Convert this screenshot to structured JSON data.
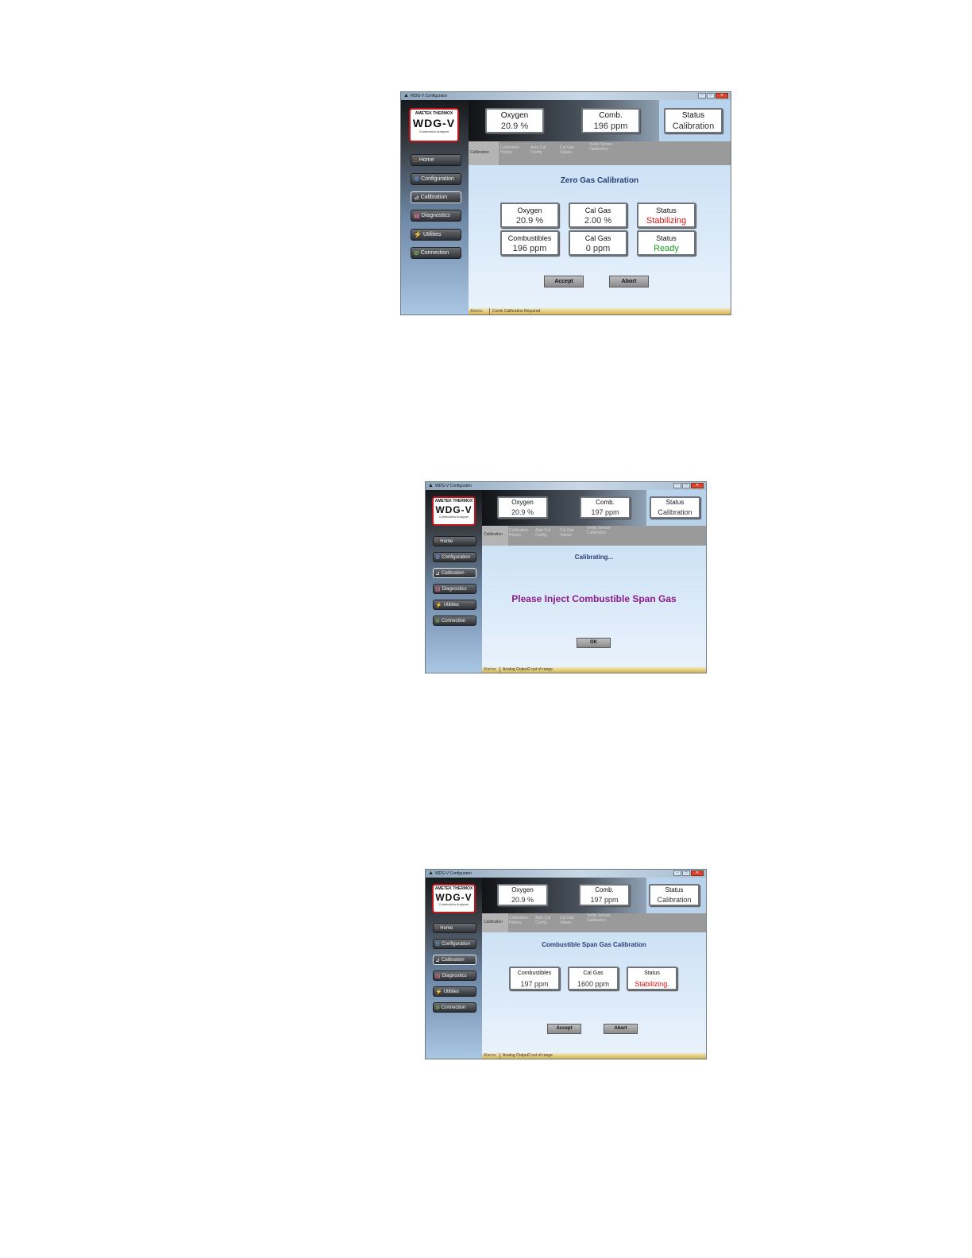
{
  "window_title": "WDG-V Configurator",
  "logo": {
    "brand": "AMETEK THERMOX",
    "product": "WDG-V",
    "subtitle": "Combustion Analyzer"
  },
  "nav": [
    {
      "label": "Home",
      "icon": "home-icon"
    },
    {
      "label": "Configuration",
      "icon": "gear-icon"
    },
    {
      "label": "Calibration",
      "icon": "calibration-icon"
    },
    {
      "label": "Diagnostics",
      "icon": "document-icon"
    },
    {
      "label": "Utilities",
      "icon": "wrench-icon"
    },
    {
      "label": "Connection",
      "icon": "connection-icon"
    }
  ],
  "tabs": [
    "Calibration",
    "Calibration History",
    "Auto Cal Config",
    "Cal Gas Values",
    "Verify Sensor Calibration"
  ],
  "alarms_label": "Alarms",
  "screens": [
    {
      "top": {
        "oxygen_label": "Oxygen",
        "oxygen_value": "20.9 %",
        "comb_label": "Comb.",
        "comb_value": "196 ppm",
        "status_label": "Status",
        "status_value": "Calibration"
      },
      "title": "Zero Gas Calibration",
      "rows": [
        [
          {
            "label": "Oxygen",
            "value": "20.9 %"
          },
          {
            "label": "Cal Gas",
            "value": "2.00 %"
          },
          {
            "label": "Status",
            "value": "Stabilizing",
            "color": "#e01414"
          }
        ],
        [
          {
            "label": "Combustibles",
            "value": "196 ppm"
          },
          {
            "label": "Cal Gas",
            "value": "0 ppm"
          },
          {
            "label": "Status",
            "value": "Ready",
            "color": "#1a9a2a"
          }
        ]
      ],
      "buttons": [
        "Accept",
        "Abort"
      ],
      "alarm": "Comb Calibration Required"
    },
    {
      "top": {
        "oxygen_label": "Oxygen",
        "oxygen_value": "20.9 %",
        "comb_label": "Comb.",
        "comb_value": "197 ppm",
        "status_label": "Status",
        "status_value": "Calibration"
      },
      "title": "Calibrating...",
      "message": "Please Inject Combustible Span Gas",
      "buttons": [
        "OK"
      ],
      "alarm": "Analog Output2 out of range"
    },
    {
      "top": {
        "oxygen_label": "Oxygen",
        "oxygen_value": "20.9 %",
        "comb_label": "Comb.",
        "comb_value": "197 ppm",
        "status_label": "Status",
        "status_value": "Calibration"
      },
      "title": "Combustible Span Gas Calibration",
      "rows": [
        [
          {
            "label": "Combustibles",
            "value": "197 ppm"
          },
          {
            "label": "Cal Gas",
            "value": "1600 ppm"
          },
          {
            "label": "Status",
            "value": "Stabilizing.",
            "color": "#e01414"
          }
        ]
      ],
      "buttons": [
        "Accept",
        "Abort"
      ],
      "alarm": "Analog Output2 out of range"
    }
  ]
}
